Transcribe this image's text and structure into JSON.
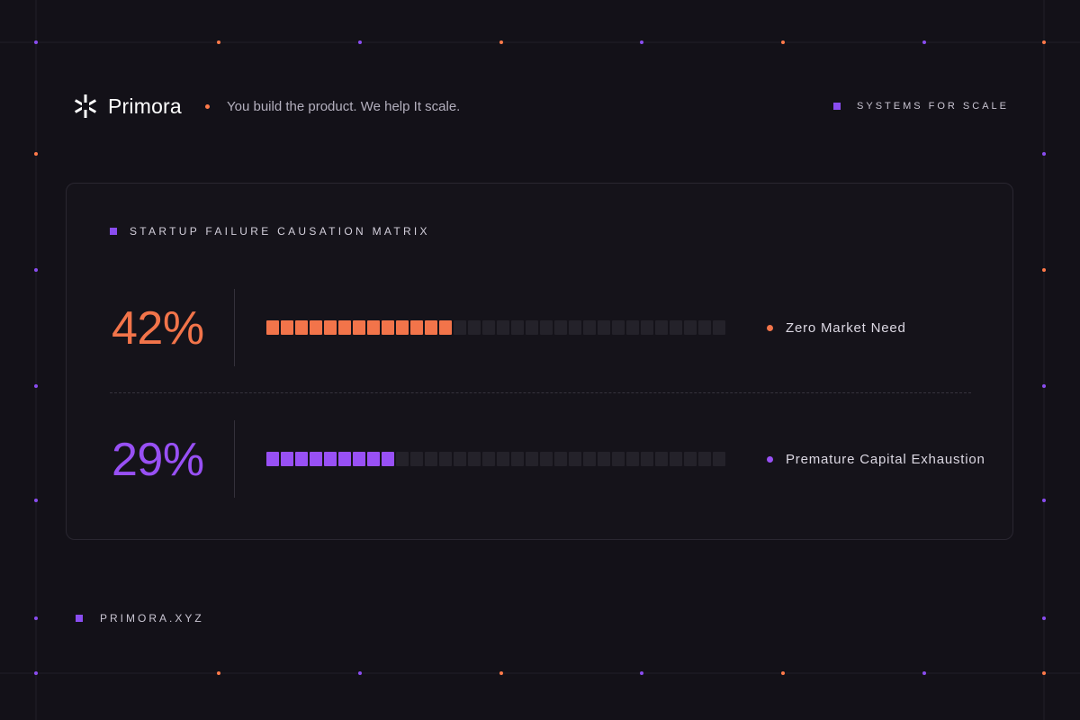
{
  "brand": {
    "name": "Primora",
    "tagline": "You build the product. We help It scale."
  },
  "header": {
    "right_label": "SYSTEMS FOR SCALE"
  },
  "matrix": {
    "title": "STARTUP FAILURE CAUSATION MATRIX",
    "total_segments": 32,
    "rows": [
      {
        "percent_label": "42%",
        "value": 42,
        "label": "Zero Market Need",
        "color": "#f2744a"
      },
      {
        "percent_label": "29%",
        "value": 29,
        "label": "Premature Capital Exhaustion",
        "color": "#9850f5"
      }
    ]
  },
  "footer": {
    "site": "PRIMORA.XYZ"
  },
  "colors": {
    "background": "#131118",
    "accent_purple": "#8a4df0",
    "accent_orange": "#ff7a4a",
    "empty_segment": "#24222a"
  },
  "icons": {
    "logo": "asterisk-logo-icon"
  }
}
